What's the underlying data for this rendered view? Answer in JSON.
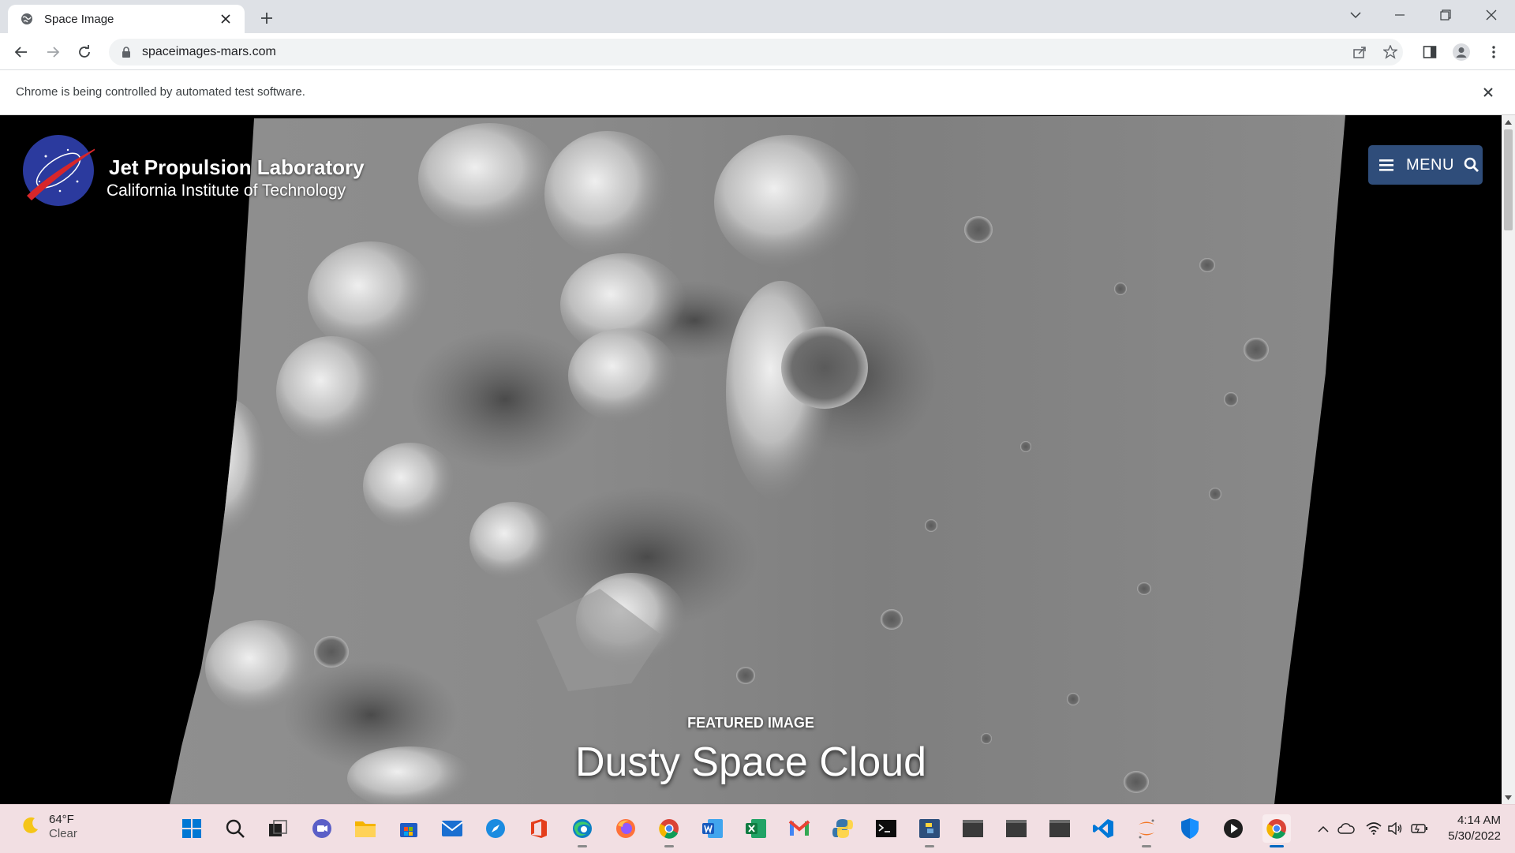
{
  "browser": {
    "tab_title": "Space Image",
    "url": "spaceimages-mars.com",
    "infobar_message": "Chrome is being controlled by automated test software."
  },
  "page": {
    "brand_title": "Jet Propulsion Laboratory",
    "brand_subtitle": "California Institute of Technology",
    "menu_label": "MENU",
    "featured_label": "FEATURED IMAGE",
    "image_title": "Dusty Space Cloud"
  },
  "taskbar": {
    "weather_temp": "64°F",
    "weather_condition": "Clear",
    "time": "4:14 AM",
    "date": "5/30/2022",
    "apps": [
      "start-icon",
      "search-icon",
      "task-view-icon",
      "teams-chat-icon",
      "file-explorer-icon",
      "store-icon",
      "mail-icon",
      "safari-icon",
      "office-icon",
      "edge-icon",
      "firefox-icon",
      "chrome-icon",
      "word-icon",
      "excel-icon",
      "gmail-icon",
      "python-idle-icon",
      "terminal-icon",
      "python-icon",
      "console-icon",
      "console-icon",
      "console-icon",
      "vscode-icon",
      "jupyter-icon",
      "defender-icon",
      "media-player-icon",
      "chrome-icon"
    ]
  },
  "colors": {
    "menu_button": "#2f4d7a",
    "taskbar": "#f2dfe3",
    "tabstrip": "#dee1e6"
  }
}
